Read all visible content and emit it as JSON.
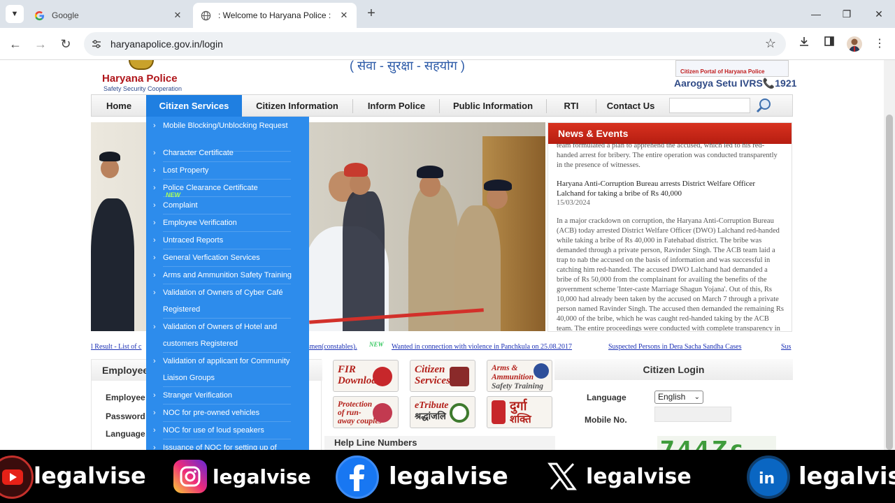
{
  "browser": {
    "tabs": [
      {
        "title": "Google",
        "active": false
      },
      {
        "title": ": Welcome to Haryana Police :",
        "active": true
      }
    ],
    "url": "haryanapolice.gov.in/login"
  },
  "site": {
    "logo_title": "Haryana Police",
    "logo_tagline": "Safety Security Cooperation",
    "motto": "( सेवा - सुरक्षा - सहयोग )",
    "portal_badge": "Citizen Portal of Haryana Police",
    "aarogya": "Aarogya Setu IVRS📞1921"
  },
  "menu": {
    "items": [
      "Home",
      "Citizen Services",
      "Citizen Information",
      "Inform Police",
      "Public Information",
      "RTI",
      "Contact Us"
    ],
    "selected": "Citizen Services"
  },
  "dropdown": {
    "new_badge": "NEW",
    "items": [
      "Mobile Blocking/Unblocking Request",
      "Character Certificate",
      "Lost Property",
      "Police Clearance Certificate",
      "Complaint",
      "Employee Verification",
      "Untraced Reports",
      "General Verfication Services",
      "Arms and Ammunition Safety Training",
      "Validation of Owners of Cyber Café",
      "Registered",
      "Validation of Owners of Hotel and",
      "customers Registered",
      "Validation of applicant for Community",
      "Liaison Groups",
      "Stranger Verification",
      "NOC for pre-owned vehicles",
      "NOC for use of loud speakers",
      "Issuance of NOC for setting up of"
    ]
  },
  "news": {
    "heading": "News & Events",
    "fragment": "team formulated a plan to apprehend the accused, which led to his red-handed arrest for bribery. The entire operation was conducted transparently in the presence of witnesses.",
    "title": "Haryana Anti-Corruption Bureau arrests District Welfare Officer Lalchand for taking a bribe of Rs 40,000",
    "date": "15/03/2024",
    "body": "In a major crackdown on corruption, the Haryana Anti-Corruption Bureau (ACB) today arrested District Welfare Officer (DWO) Lalchand red-handed while taking a bribe of Rs 40,000 in Fatehabad district. The bribe was demanded through a private person, Ravinder Singh. The ACB team laid a trap to nab the accused on the basis of information and was successful in catching him red-handed. The accused DWO Lalchand had demanded a bribe of Rs 50,000 from the complainant for availing the benefits of the government scheme 'Inter-caste Marriage Shagun Yojana'. Out of this, Rs 10,000 had already been taken by the accused on March 7 through a private person named Ravinder Singh. The accused then demanded the remaining Rs 40,000 of the bribe, which he was caught red-handed taking by the ACB team. The entire proceedings were conducted with complete transparency in the presence of witnesses."
  },
  "ticker": {
    "items": [
      "l Result - List of c",
      "tsmen(constables).",
      "Wanted in connection with violence in Panchkula on 25.08.2017",
      "Suspected Persons in Dera Sacha Sandha Cases",
      "Sus"
    ],
    "new_badge": "NEW"
  },
  "employee": {
    "heading": "Employee",
    "labels": [
      "Employee",
      "Password",
      "Language"
    ]
  },
  "tiles": [
    {
      "label_1": "FIR",
      "label_2": "Download"
    },
    {
      "label_1": "Citizen",
      "label_2": "Services"
    },
    {
      "label_1": "Arms &",
      "label_2": "Ammunition",
      "label_3": "Safety Training"
    },
    {
      "label_1": "Protection",
      "label_2": "of run-",
      "label_3": "away couples"
    },
    {
      "label_1": "eTribute",
      "label_2": "श्रद्धांजलि"
    },
    {
      "label_1": "दुर्गा",
      "label_2": "शक्ति"
    }
  ],
  "helpline": {
    "heading": "Help Line Numbers"
  },
  "login": {
    "heading": "Citizen Login",
    "language_label": "Language",
    "language_value": "English",
    "mobile_label": "Mobile No.",
    "captcha": "744Zc"
  },
  "footer": {
    "handle": "legalvise",
    "networks": [
      "youtube",
      "instagram",
      "facebook",
      "x",
      "linkedin"
    ]
  },
  "colors": {
    "menu_selected": "#1f7fe1",
    "dropdown_bg": "#2d8cec",
    "news_header": "#c8281a",
    "ticker_link": "#1a2fb5"
  }
}
